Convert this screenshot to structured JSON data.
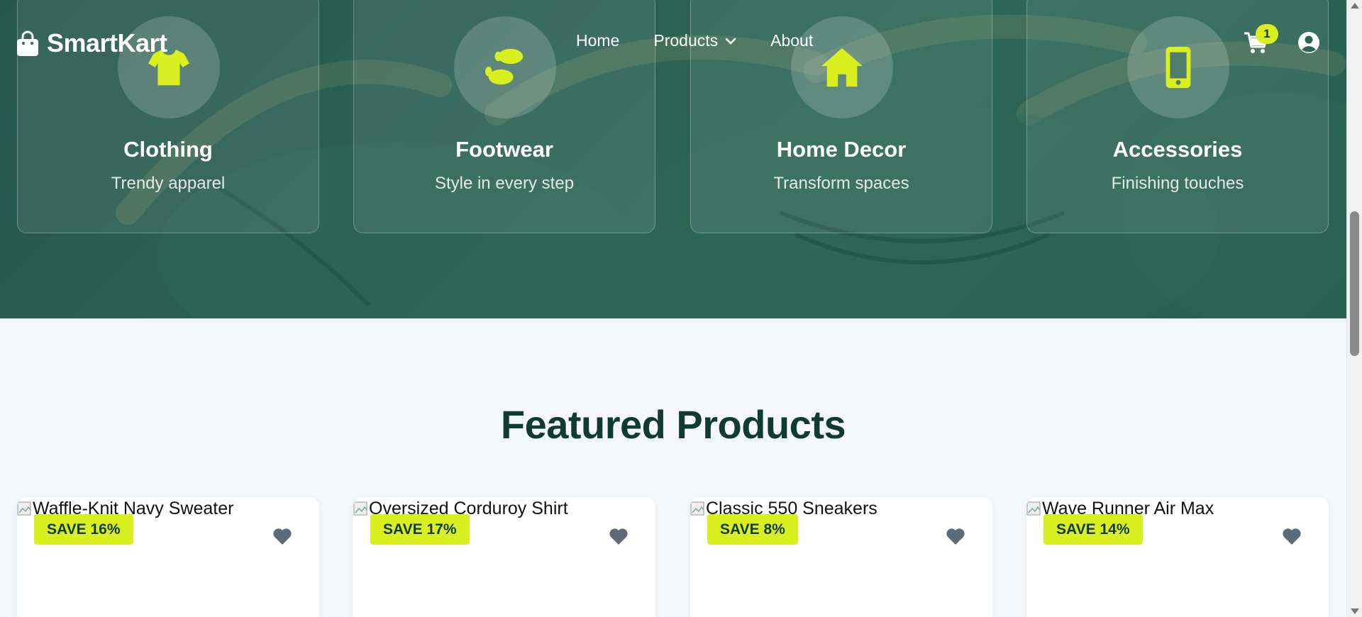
{
  "brand": {
    "name": "SmartKart",
    "accent": "#d9ef1f",
    "dark": "#0f3b30"
  },
  "nav": {
    "home": "Home",
    "products": "Products",
    "about": "About"
  },
  "cart": {
    "count": "1"
  },
  "categories": [
    {
      "title": "Clothing",
      "subtitle": "Trendy apparel",
      "icon": "tshirt-icon"
    },
    {
      "title": "Footwear",
      "subtitle": "Style in every step",
      "icon": "footprints-icon"
    },
    {
      "title": "Home Decor",
      "subtitle": "Transform spaces",
      "icon": "house-icon"
    },
    {
      "title": "Accessories",
      "subtitle": "Finishing touches",
      "icon": "phone-icon"
    }
  ],
  "featured": {
    "title": "Featured Products",
    "products": [
      {
        "alt": "Waffle-Knit Navy Sweater",
        "badge": "SAVE 16%"
      },
      {
        "alt": "Oversized Corduroy Shirt",
        "badge": "SAVE 17%"
      },
      {
        "alt": "Classic 550 Sneakers",
        "badge": "SAVE 8%"
      },
      {
        "alt": "Wave Runner Air Max",
        "badge": "SAVE 14%"
      }
    ]
  }
}
